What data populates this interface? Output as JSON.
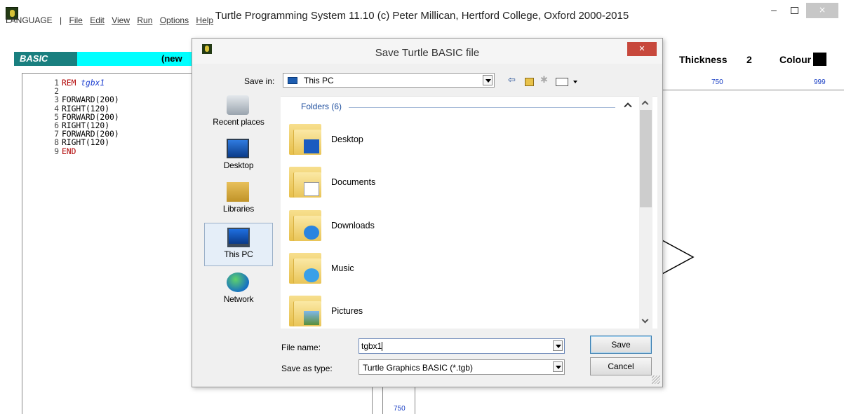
{
  "window": {
    "title": "Turtle Programming System 11.10  (c) Peter Millican, Hertford College, Oxford 2000-2015",
    "min_glyph": "–",
    "close_glyph": "×"
  },
  "menu": {
    "language": "LANGUAGE",
    "sep": "|",
    "items": [
      "File",
      "Edit",
      "View",
      "Run",
      "Options",
      "Help"
    ]
  },
  "editor": {
    "mode": "BASIC",
    "file_label": "(new",
    "lines": [
      {
        "n": "1",
        "kw": "REM",
        "arg": "tgbx1"
      },
      {
        "n": "2",
        "kw": "",
        "arg": ""
      },
      {
        "n": "3",
        "kw": "",
        "arg": "FORWARD(200)"
      },
      {
        "n": "4",
        "kw": "",
        "arg": "RIGHT(120)"
      },
      {
        "n": "5",
        "kw": "",
        "arg": "FORWARD(200)"
      },
      {
        "n": "6",
        "kw": "",
        "arg": "RIGHT(120)"
      },
      {
        "n": "7",
        "kw": "",
        "arg": "FORWARD(200)"
      },
      {
        "n": "8",
        "kw": "",
        "arg": "RIGHT(120)"
      },
      {
        "n": "9",
        "kw": "END",
        "arg": ""
      }
    ]
  },
  "status": {
    "thickness_label": "Thickness",
    "thickness_value": "2",
    "colour_label": "Colour",
    "colour": "#000000"
  },
  "canvas": {
    "x_ticks": [
      "750",
      "999"
    ],
    "y_tick": "750"
  },
  "dialog": {
    "title": "Save Turtle BASIC file",
    "close_glyph": "✕",
    "save_in_label": "Save in:",
    "save_in_value": "This PC",
    "places": [
      "Recent places",
      "Desktop",
      "Libraries",
      "This PC",
      "Network"
    ],
    "group_header": "Folders (6)",
    "folders": [
      "Desktop",
      "Documents",
      "Downloads",
      "Music",
      "Pictures"
    ],
    "file_name_label": "File name:",
    "file_name_value": "tgbx1",
    "save_type_label": "Save as type:",
    "save_type_value": "Turtle Graphics BASIC (*.tgb)",
    "save_button": "Save",
    "cancel_button": "Cancel"
  }
}
